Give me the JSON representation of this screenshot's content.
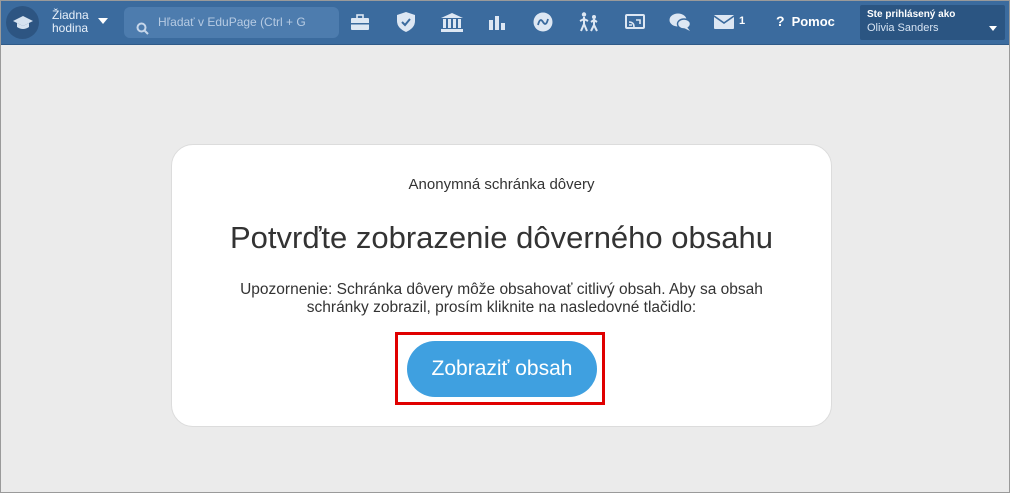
{
  "topbar": {
    "hour_label": "Žiadna hodina",
    "search_placeholder": "Hľadať v EduPage (Ctrl + G",
    "messages_count": "1",
    "help_label": "Pomoc",
    "user": {
      "label": "Ste prihlásený ako",
      "name": "Olivia Sanders"
    },
    "icons": [
      "graduation-cap-icon",
      "briefcase-icon",
      "shield-check-icon",
      "bank-icon",
      "bar-chart-icon",
      "zodiac-icon",
      "walking-kids-icon",
      "cast-screen-icon",
      "chat-bubbles-icon",
      "envelope-icon"
    ]
  },
  "card": {
    "subtitle": "Anonymná schránka dôvery",
    "title": "Potvrďte zobrazenie dôverného obsahu",
    "warning": "Upozornenie: Schránka dôvery môže obsahovať citlivý obsah. Aby sa obsah schránky zobrazil, prosím kliknite na nasledovné tlačidlo:",
    "button_label": "Zobraziť obsah"
  },
  "colors": {
    "topbar": "#3b6b9e",
    "button": "#3fa0e0",
    "highlight": "#e00000",
    "background": "#ebebeb"
  }
}
